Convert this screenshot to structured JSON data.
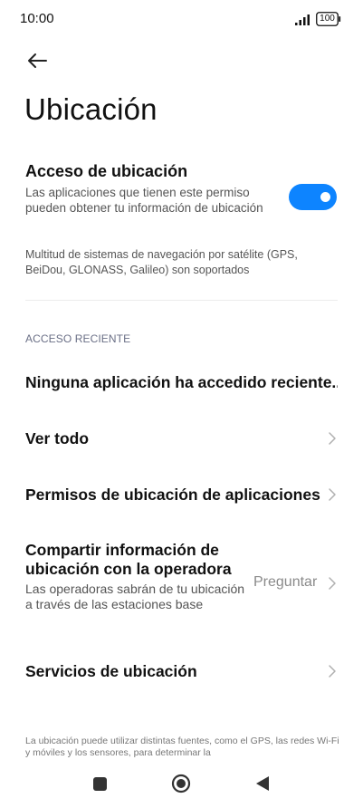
{
  "status_bar": {
    "time": "10:00",
    "battery": "100",
    "icons": [
      "signal-icon",
      "battery-icon"
    ]
  },
  "header": {
    "back_icon": "arrow-left-icon",
    "title": "Ubicación"
  },
  "location_access": {
    "title": "Acceso de ubicación",
    "description": "Las aplicaciones que tienen este permiso pueden obtener tu información de ubicación",
    "enabled": true,
    "accent_color": "#0d84ff"
  },
  "gnss_note": "Multitud de sistemas de navegación por satélite (GPS, BeiDou, GLONASS, Galileo) son soportados",
  "recent_access": {
    "header": "ACCESO RECIENTE",
    "none_label": "Ninguna aplicación ha accedido reciente.."
  },
  "rows": {
    "view_all": "Ver todo",
    "app_permissions": "Permisos de ubicación de aplicaciones",
    "carrier": {
      "title": "Compartir información de ubicación con la operadora",
      "description": "Las operadoras sabrán de tu ubicación a través de las estaciones base",
      "value": "Preguntar"
    },
    "location_services": "Servicios de ubicación"
  },
  "footer_note": "La ubicación puede utilizar distintas fuentes, como el GPS, las redes Wi-Fi y móviles y los sensores, para determinar la",
  "nav_bar": {
    "icons": [
      "recents-icon",
      "home-icon",
      "back-triangle-icon"
    ]
  }
}
